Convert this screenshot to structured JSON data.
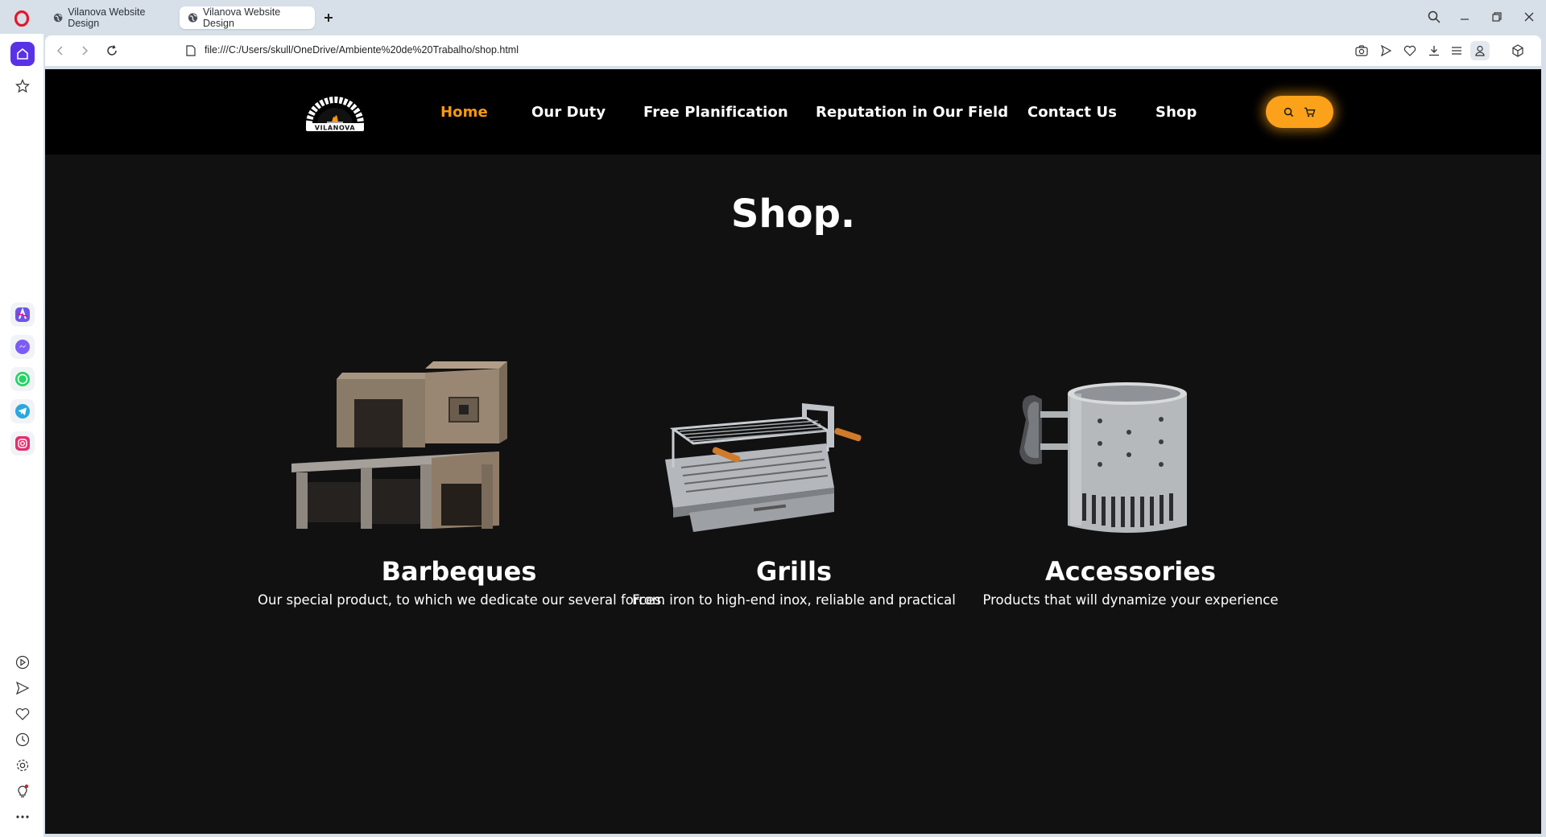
{
  "browser": {
    "tabs": [
      {
        "label": "Vilanova Website Design",
        "active": false
      },
      {
        "label": "Vilanova Website Design",
        "active": true
      }
    ],
    "url": "file:///C:/Users/skull/OneDrive/Ambiente%20de%20Trabalho/shop.html",
    "accent_color": "#5a32e6"
  },
  "sidebar": {
    "icons": [
      "home-icon",
      "star-icon",
      "aria-icon",
      "messenger-icon",
      "whatsapp-icon",
      "telegram-icon",
      "instagram-icon",
      "player-icon",
      "send-icon",
      "heart-icon",
      "history-icon",
      "settings-icon",
      "tips-icon",
      "more-icon"
    ]
  },
  "site": {
    "logo_text": "VILANOVA",
    "nav": [
      "Home",
      "Our Duty",
      "Free Planification",
      "Reputation in Our Field",
      "Contact Us",
      "Shop"
    ],
    "active_nav": "Home",
    "accent_color": "#f99a0b",
    "page_title": "Shop.",
    "products": [
      {
        "title": "Barbeques",
        "description": "Our special product, to which we dedicate our several forces."
      },
      {
        "title": "Grills",
        "description": "From iron to high-end inox, reliable and practical"
      },
      {
        "title": "Accessories",
        "description": "Products that will dynamize your experience"
      }
    ]
  }
}
